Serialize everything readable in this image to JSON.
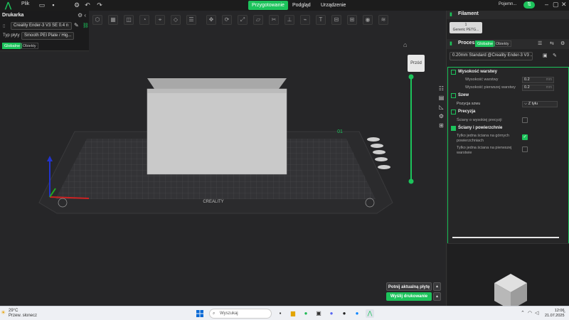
{
  "app": {
    "menu_label": "Plik",
    "tabs": [
      "Przygotowanie",
      "Podgląd",
      "Urządzenie"
    ],
    "user": "Pojemn...",
    "colors": {
      "accent": "#1cc35b",
      "plate": "#2a2a2a",
      "model": "#c9c9c9"
    }
  },
  "printer": {
    "title": "Drukarka",
    "printer_name": "Creality Ender-3 V3 SE 0.4 n",
    "plate_label": "Typ płyty",
    "plate_value": "Smooth PEI Plate / Hig...",
    "tabs": [
      "Globalne",
      "Obiekty"
    ]
  },
  "viewport": {
    "view_label": "Przód",
    "plate_brand": "CREALITY",
    "plate_number": "01",
    "slice_plate_button": "Potnij aktualną płytę",
    "print_button": "Wyślij drukowanie"
  },
  "filament": {
    "title": "Filament",
    "slot": "1",
    "name": "Generic PETG..."
  },
  "process": {
    "title": "Proces",
    "tabs": [
      "Globalne",
      "Obiekty"
    ],
    "preset": "0.20mm Standard @Creality Ender-3 V3 ...",
    "sections": {
      "layer_height": {
        "title": "Wysokość warstwy",
        "rows": [
          {
            "label": "Wysokość warstwy",
            "value": "0.2",
            "unit": "mm"
          },
          {
            "label": "Wysokość pierwszej warstwy",
            "value": "0.2",
            "unit": "mm"
          }
        ]
      },
      "seam": {
        "title": "Szew",
        "label": "Pozycja szwu",
        "value": "Z tyłu"
      },
      "precision": {
        "title": "Precyzja",
        "label": "Ściany o wysokiej precyzji"
      },
      "walls": {
        "title": "Ściany i powierzchnie",
        "label1": "Tylko jedna ściana na górnych powierzchniach",
        "label2": "Tylko jedna ściana na pierwszej warstwie"
      }
    }
  },
  "taskbar": {
    "temp": "29°C",
    "weather": "Przew. słonecz",
    "search": "Wyszukaj",
    "time": "12:06",
    "date": "21.07.2025"
  }
}
